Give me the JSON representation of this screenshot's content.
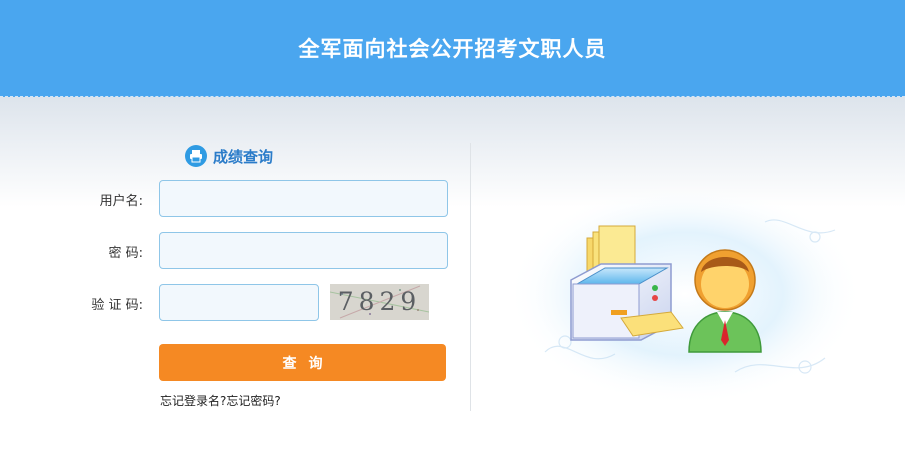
{
  "header": {
    "title": "全军面向社会公开招考文职人员"
  },
  "panel": {
    "title": "成绩查询",
    "icon": "printer-icon"
  },
  "form": {
    "username_label": "用户名:",
    "username_value": "",
    "password_label": "密 码:",
    "password_value": "",
    "captcha_label": "验 证 码:",
    "captcha_value": "",
    "captcha_image_text": "7829",
    "submit_label": "查询"
  },
  "links": {
    "forgot_username": "忘记登录名?",
    "forgot_password": "忘记密码?"
  },
  "colors": {
    "header": "#4aa6ef",
    "accent": "#f58923",
    "title": "#2b7cc9"
  }
}
